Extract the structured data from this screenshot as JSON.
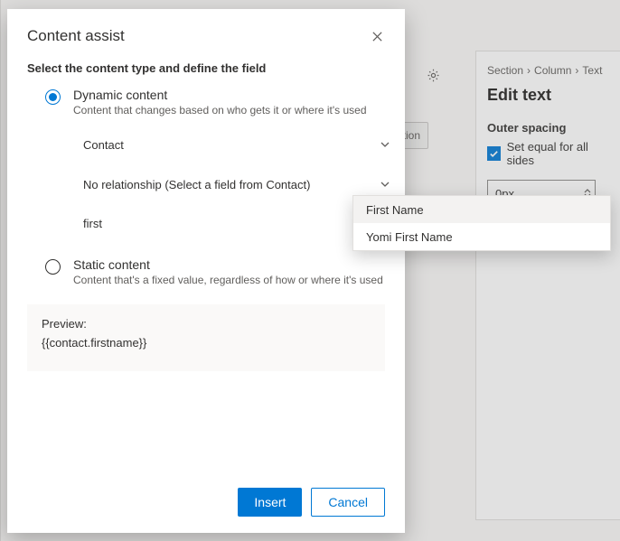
{
  "dialog": {
    "title": "Content assist",
    "instruction": "Select the content type and define the field",
    "options": {
      "dynamic": {
        "title": "Dynamic content",
        "desc": "Content that changes based on who gets it or where it's used"
      },
      "static": {
        "title": "Static content",
        "desc": "Content that's a fixed value, regardless of how or where it's used"
      }
    },
    "entity_dropdown": "Contact",
    "relationship_dropdown": "No relationship (Select a field from Contact)",
    "search_value": "first",
    "preview_label": "Preview:",
    "preview_value": "{{contact.firstname}}",
    "buttons": {
      "insert": "Insert",
      "cancel": "Cancel"
    }
  },
  "suggestions": [
    "First Name",
    "Yomi First Name"
  ],
  "side_panel": {
    "breadcrumb": [
      "Section",
      "Column",
      "Text"
    ],
    "heading": "Edit text",
    "spacing_label": "Outer spacing",
    "equal_sides": "Set equal for all sides",
    "spacing_value": "0px"
  },
  "bg": {
    "pill": "zation"
  }
}
